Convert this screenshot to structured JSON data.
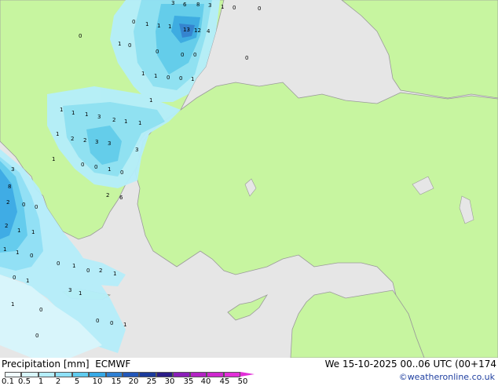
{
  "title": "Precipitation [mm]",
  "model": "ECMWF",
  "datetime": "We 15-10-2025 00..06 UTC (00+174",
  "credit": "©weatheronline.co.uk",
  "scale_labels": [
    "0.1",
    "0.5",
    "1",
    "2",
    "5",
    "10",
    "15",
    "20",
    "25",
    "30",
    "35",
    "40",
    "45",
    "50"
  ],
  "scale_colors": [
    "#f0fcff",
    "#d8f6fd",
    "#b5eefb",
    "#8ee0f6",
    "#5fcbee",
    "#37a9e5",
    "#2e7fd2",
    "#2357b9",
    "#1b3a9a",
    "#2a1c86",
    "#8a1fb8",
    "#b323c4",
    "#cf28cf",
    "#e22fd8"
  ],
  "colors": {
    "sea": "#e6e6e6",
    "land": "#c7f5a0",
    "border": "#9a9a9a"
  },
  "value_labels": [
    "3",
    "6",
    "8",
    "3",
    "1",
    "0",
    "0",
    "13",
    "12",
    "4",
    "1",
    "1",
    "1",
    "0",
    "0",
    "1",
    "0",
    "0",
    "0",
    "0",
    "0",
    "1",
    "1",
    "0",
    "0",
    "1",
    "3",
    "8",
    "2",
    "0",
    "0",
    "2",
    "1",
    "1",
    "1",
    "1",
    "1",
    "3",
    "2",
    "1",
    "1",
    "1",
    "2",
    "2",
    "3",
    "3",
    "1",
    "1",
    "0",
    "0",
    "1",
    "0",
    "3",
    "2",
    "6",
    "1",
    "1",
    "0",
    "0",
    "1",
    "0",
    "2",
    "1",
    "0",
    "1",
    "3",
    "1",
    "1",
    "0",
    "0",
    "0",
    "1",
    "0"
  ]
}
